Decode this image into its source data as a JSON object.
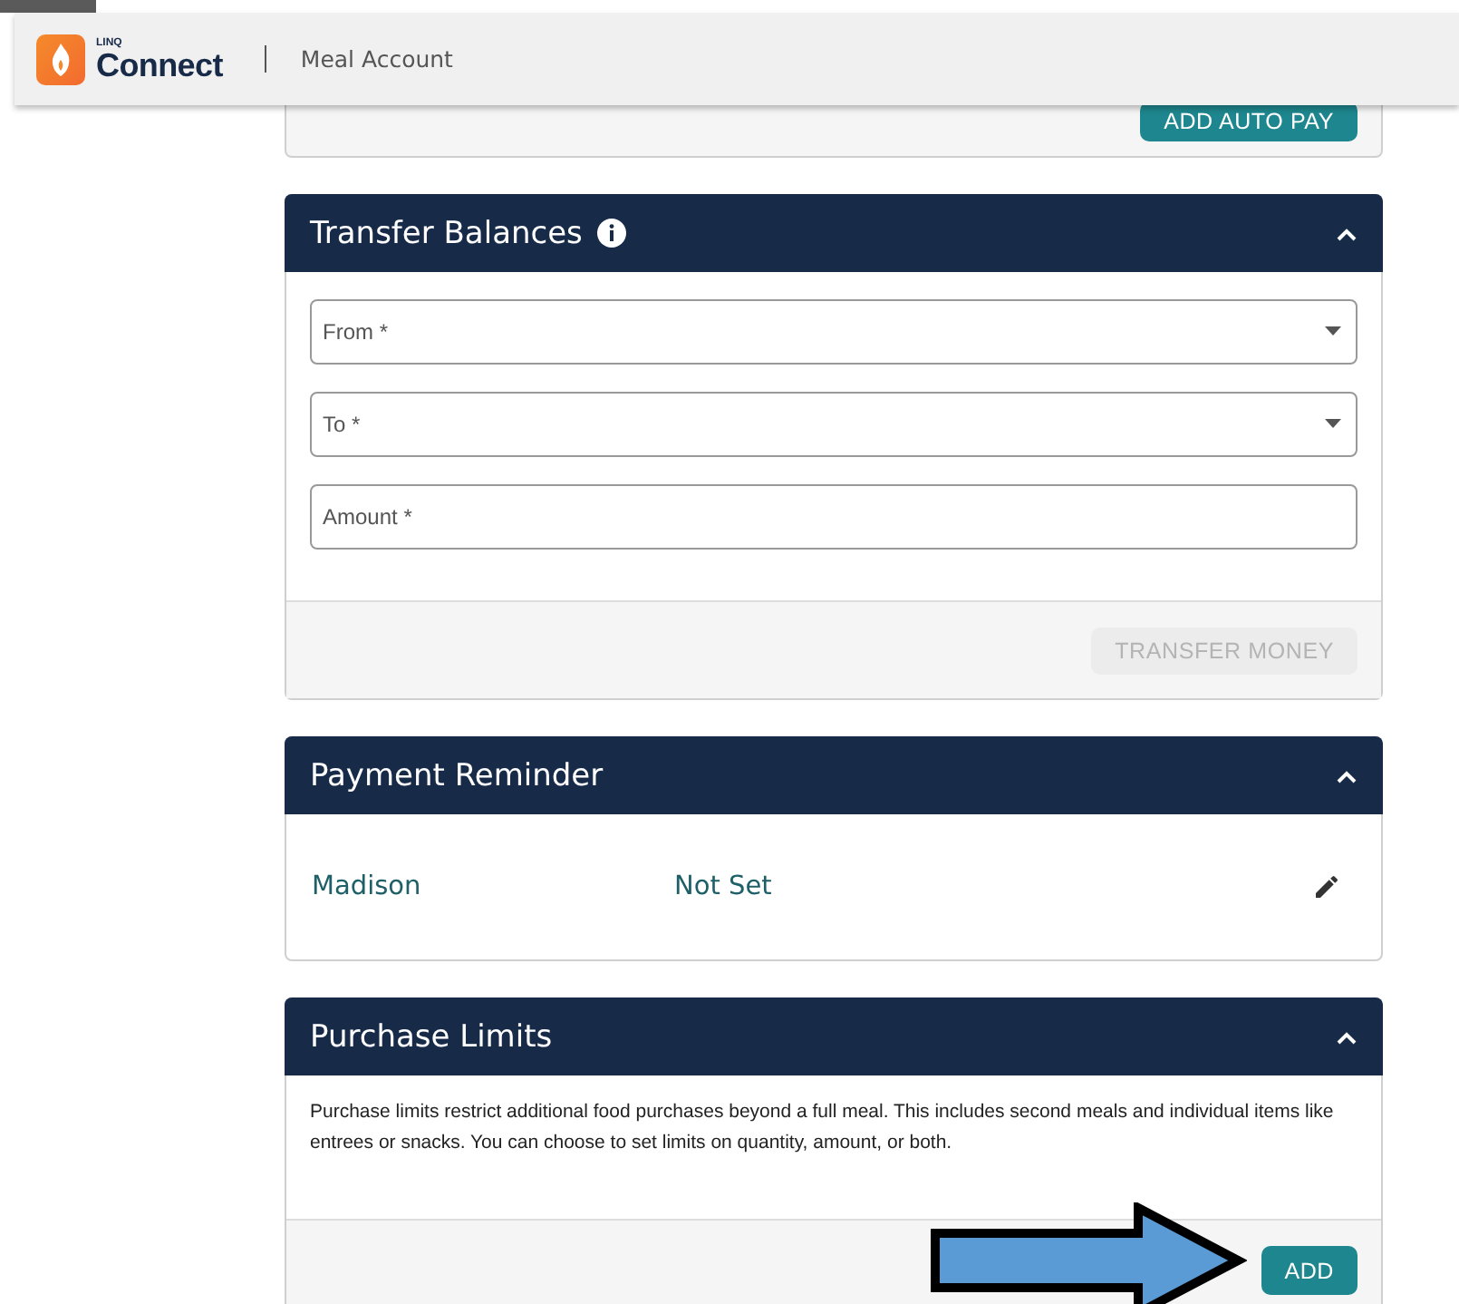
{
  "header": {
    "brand_small": "LINQ",
    "brand": "Connect",
    "page_title": "Meal Account"
  },
  "auto_pay": {
    "button": "ADD AUTO PAY"
  },
  "transfer_balances": {
    "title": "Transfer Balances",
    "expanded": true,
    "fields": [
      {
        "kind": "select",
        "placeholder": "From *"
      },
      {
        "kind": "select",
        "placeholder": "To *"
      },
      {
        "kind": "text",
        "placeholder": "Amount *"
      }
    ],
    "button": {
      "label": "TRANSFER MONEY",
      "disabled": true
    }
  },
  "payment_reminder": {
    "title": "Payment Reminder",
    "expanded": true,
    "rows": [
      {
        "name": "Madison",
        "status": "Not Set"
      }
    ]
  },
  "purchase_limits": {
    "title": "Purchase Limits",
    "expanded": true,
    "description": "Purchase limits restrict additional food purchases beyond a full meal. This includes second meals and individual items like entrees or snacks. You can choose to set limits on quantity, amount, or both.",
    "button": "ADD"
  }
}
